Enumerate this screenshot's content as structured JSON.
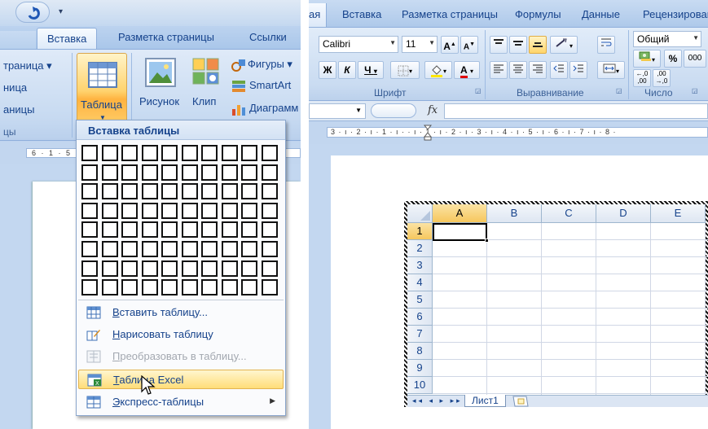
{
  "word": {
    "tabs": [
      "Вставка",
      "Разметка страницы",
      "Ссылки"
    ],
    "page_group": {
      "items": [
        "траница ▾",
        "ница",
        "аницы"
      ],
      "label": "цы"
    },
    "table_button": "Таблица",
    "picture_button": "Рисунок",
    "clip_button": "Клип",
    "illustrations": [
      "Фигуры ▾",
      "SmartArt",
      "Диаграмм"
    ],
    "ruler_text": "6 · 1 · 5 ·",
    "dropdown": {
      "header": "Вставка таблицы",
      "grid_cols": 10,
      "grid_rows": 8,
      "items": [
        {
          "label": "Вставить таблицу...",
          "icon": "insert-table-icon",
          "state": "normal",
          "hotkey": "В"
        },
        {
          "label": "Нарисовать таблицу",
          "icon": "draw-table-icon",
          "state": "normal",
          "hotkey": "Н"
        },
        {
          "label": "Преобразовать в таблицу...",
          "icon": "convert-table-icon",
          "state": "disabled",
          "hotkey": "П"
        },
        {
          "label": "Таблица Excel",
          "icon": "excel-table-icon",
          "state": "highlighted",
          "hotkey": "Т"
        },
        {
          "label": "Экспресс-таблицы",
          "icon": "quick-tables-icon",
          "state": "submenu",
          "hotkey": "Э"
        }
      ]
    }
  },
  "excel": {
    "tabs": [
      "ая",
      "Вставка",
      "Разметка страницы",
      "Формулы",
      "Данные",
      "Рецензирован"
    ],
    "font_name": "Calibri",
    "font_size": "11",
    "font_group_label": "Шрифт",
    "align_group_label": "Выравнивание",
    "number_group_label": "Число",
    "number_format": "Общий",
    "percent": "%",
    "thousands": "000",
    "bold": "Ж",
    "italic": "К",
    "underline": "Ч",
    "grow_font": "A",
    "shrink_font": "A",
    "font_color": "A",
    "fx_label": "fx",
    "ruler_text": "3 · ı · 2 · ı · 1 · ı ·   · ı · 1 · ı · 2 · ı · 3 · ı · 4 · ı · 5 · ı · 6 · ı · 7 · ı · 8 ·",
    "columns": [
      "A",
      "B",
      "C",
      "D",
      "E"
    ],
    "rows": [
      "1",
      "2",
      "3",
      "4",
      "5",
      "6",
      "7",
      "8",
      "9",
      "10"
    ],
    "sheet_tab": "Лист1",
    "sheet_nav": "◂◂ ◂ ▸ ▸▸",
    "active_cell": "A1"
  },
  "colors": {
    "ribbon": "#c9dbf1",
    "highlight": "#ffd36e",
    "text": "#15428b"
  }
}
